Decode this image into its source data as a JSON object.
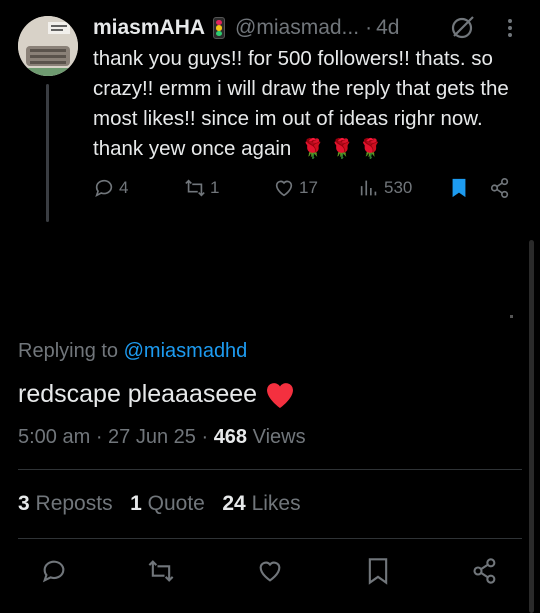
{
  "tweet": {
    "author_name": "miasmAHA",
    "handle": "@miasmad...",
    "separator": "·",
    "age": "4d",
    "text": "thank you guys!! for 500 followers!! thats. so crazy!! ermm i will draw the reply that gets the most likes!! since im out of ideas righr now. thank yew once again",
    "emoji_tail": "🌹 🌹 🌹",
    "replies": "4",
    "reposts": "1",
    "likes": "17",
    "views": "530"
  },
  "reply": {
    "replying_prefix": "Replying to",
    "replying_to": "@miasmadhd",
    "text": "redscape pleaaaseee",
    "time": "5:00 am",
    "date": "27 Jun 25",
    "views_count": "468",
    "views_label": "Views",
    "reposts_count": "3",
    "reposts_label": "Reposts",
    "quotes_count": "1",
    "quotes_label": "Quote",
    "likes_count": "24",
    "likes_label": "Likes"
  },
  "colors": {
    "background": "#000000",
    "text": "#e7e9ea",
    "muted": "#71767b",
    "accent": "#1d9bf0",
    "divider": "#2f3336",
    "heart": "#f91880"
  },
  "icons": [
    "avatar-image",
    "traffic-light-icon",
    "grok-icon",
    "more-icon",
    "reply-icon",
    "repost-icon",
    "like-icon",
    "views-icon",
    "bookmark-icon",
    "share-icon",
    "heart-emoji"
  ]
}
